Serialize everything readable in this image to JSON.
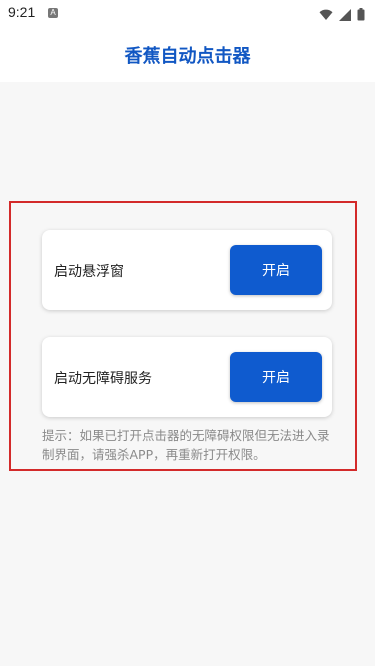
{
  "status_bar": {
    "time": "9:21",
    "notification_icon": "a-icon",
    "icons": [
      "wifi-icon",
      "signal-icon",
      "battery-icon"
    ]
  },
  "header": {
    "title": "香蕉自动点击器",
    "title_color": "#1157c3"
  },
  "cards": [
    {
      "label": "启动悬浮窗",
      "button_label": "开启"
    },
    {
      "label": "启动无障碍服务",
      "button_label": "开启"
    }
  ],
  "hint": "提示：如果已打开点击器的无障碍权限但无法进入录制界面，请强杀APP，再重新打开权限。",
  "colors": {
    "accent": "#0f5bcf",
    "highlight_frame": "#d32a2a"
  }
}
